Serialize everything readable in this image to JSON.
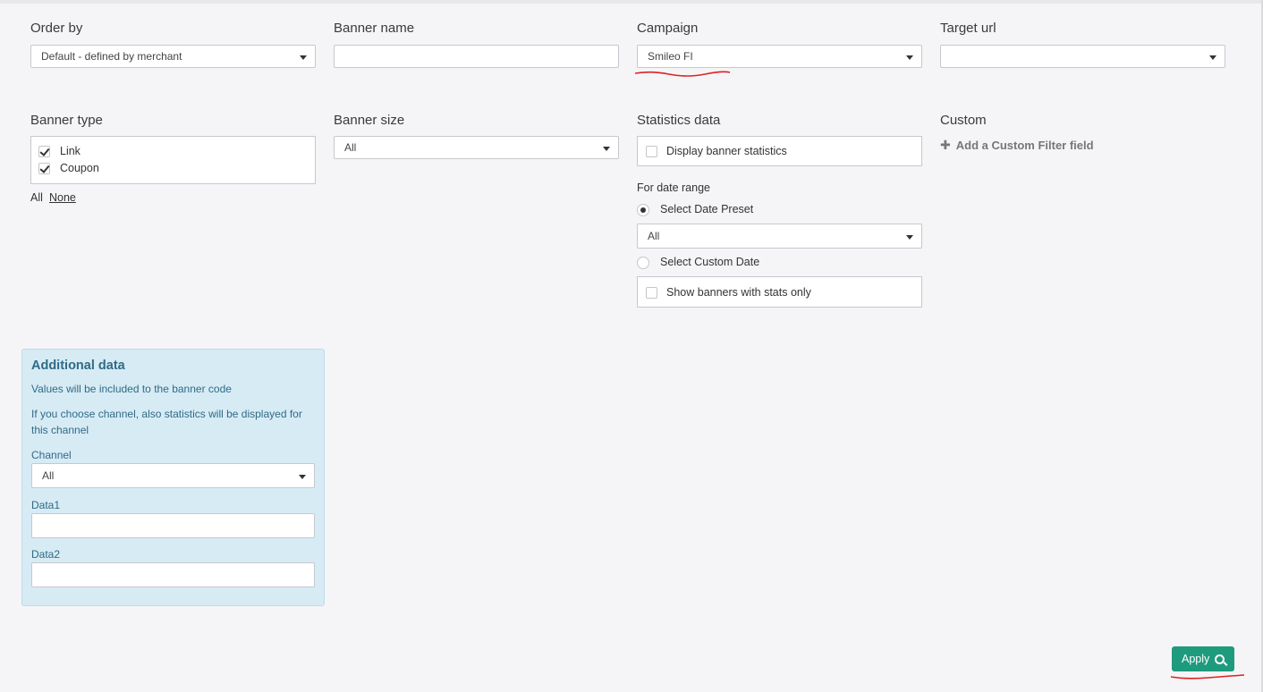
{
  "filters": {
    "order_by": {
      "label": "Order by",
      "value": "Default - defined by merchant"
    },
    "banner_name": {
      "label": "Banner name",
      "value": ""
    },
    "campaign": {
      "label": "Campaign",
      "value": "Smileo FI"
    },
    "target_url": {
      "label": "Target url",
      "value": ""
    },
    "banner_type": {
      "label": "Banner type",
      "options": [
        {
          "label": "Link",
          "checked": true
        },
        {
          "label": "Coupon",
          "checked": true
        }
      ],
      "all_label": "All",
      "none_label": "None"
    },
    "banner_size": {
      "label": "Banner size",
      "value": "All"
    },
    "statistics": {
      "label": "Statistics data",
      "display_stats_label": "Display banner statistics",
      "display_stats_checked": false,
      "date_range_label": "For date range",
      "preset_radio_label": "Select Date Preset",
      "preset_selected": true,
      "preset_value": "All",
      "custom_radio_label": "Select Custom Date",
      "stats_only_label": "Show banners with stats only",
      "stats_only_checked": false
    },
    "custom": {
      "label": "Custom",
      "add_label": "Add a Custom Filter field"
    }
  },
  "additional_data": {
    "title": "Additional data",
    "note1": "Values will be included to the banner code",
    "note2_line1": "If you choose channel, also statistics will be displayed for",
    "note2_line2": "this channel",
    "channel_label": "Channel",
    "channel_value": "All",
    "data1_label": "Data1",
    "data1_value": "",
    "data2_label": "Data2",
    "data2_value": ""
  },
  "apply_label": "Apply",
  "colors": {
    "accent": "#1e9a7d",
    "annotation": "#e02020",
    "panel": "#d7ebf5"
  },
  "icons": {
    "apply": "search-icon",
    "custom_add": "plus-icon",
    "dropdown": "caret-down-icon"
  }
}
